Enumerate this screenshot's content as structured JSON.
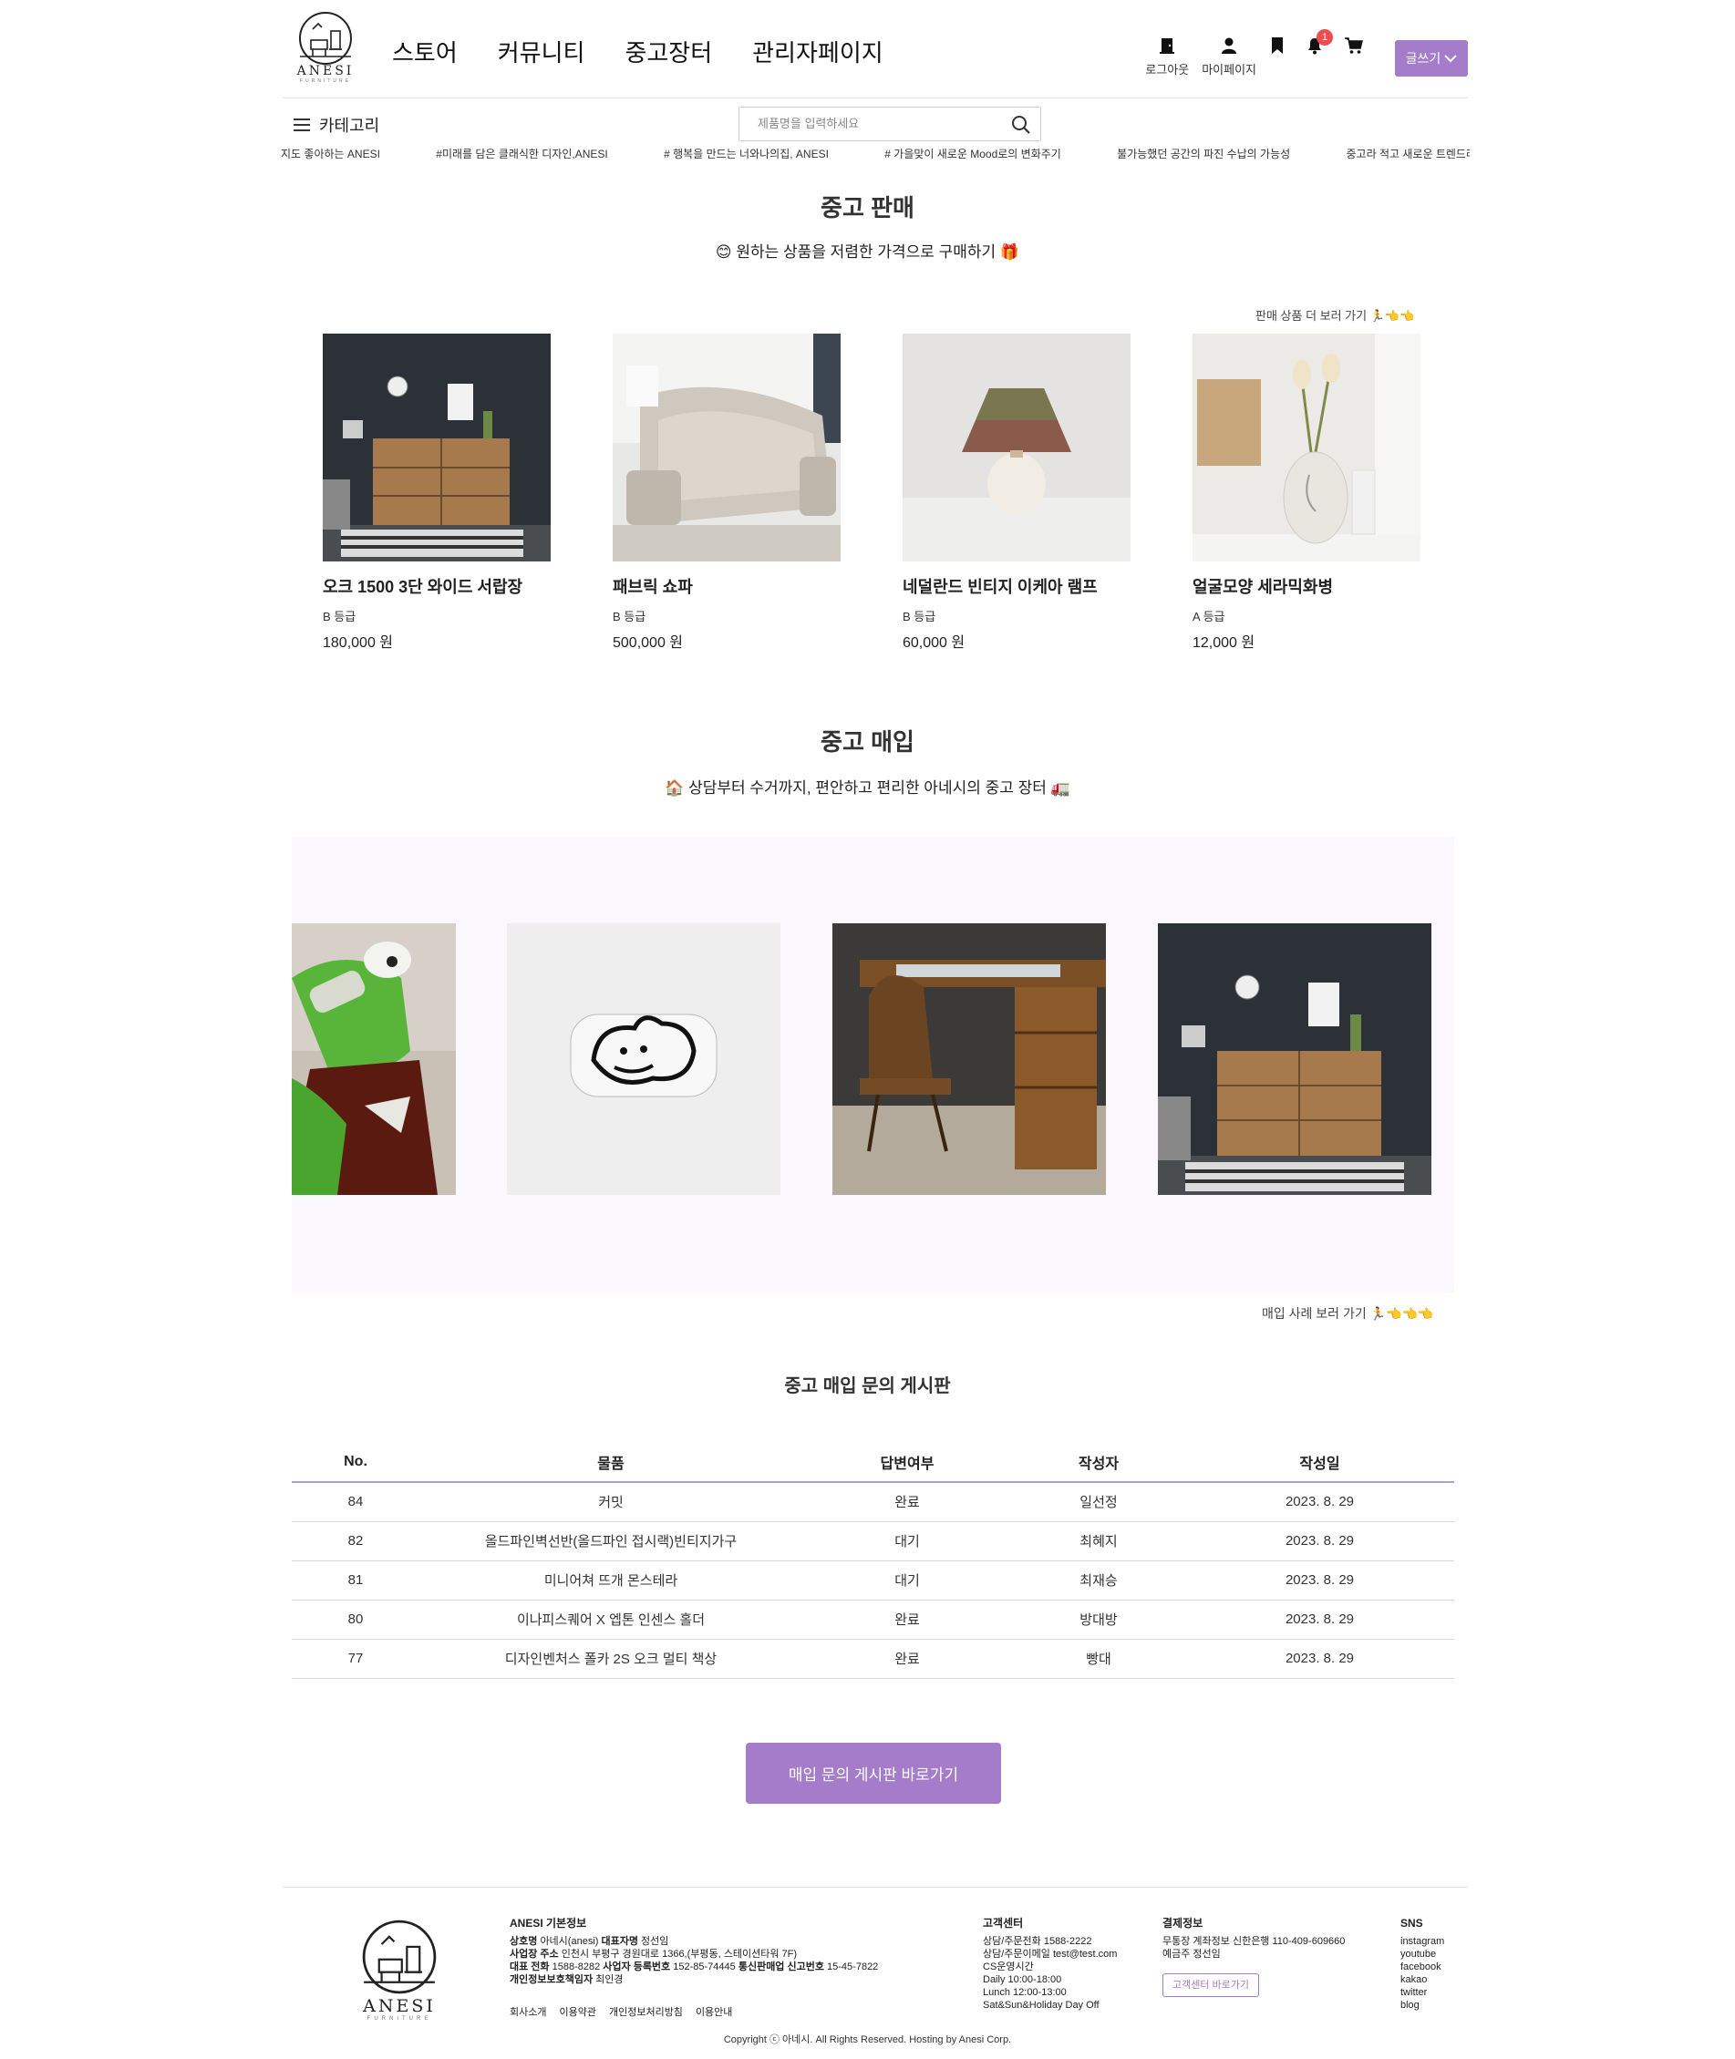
{
  "brand": {
    "name": "ANESI",
    "sub": "FURNITURE"
  },
  "nav": {
    "items": [
      "스토어",
      "커뮤니티",
      "중고장터",
      "관리자페이지"
    ]
  },
  "user_nav": {
    "logout": "로그아웃",
    "mypage": "마이페이지",
    "notification_count": "1",
    "write": "글쓰기"
  },
  "category": {
    "label": "카테고리"
  },
  "search": {
    "placeholder": "제품명을 입력하세요"
  },
  "ticker": [
    "지도 좋아하는 ANESI",
    "#미래를 담은 클래식한 디자인,ANESI",
    "# 행복을 만드는 너와나의집, ANESI",
    "# 가을맞이 새로운 Mood로의 변화주기",
    "불가능했던 공간의 파진 수납의 가능성",
    "중고라 적고 새로운 트렌드라"
  ],
  "sale": {
    "title": "중고 판매",
    "subtitle": "원하는 상품을 저렴한 가격으로 구매하기",
    "more": "판매 상품 더 보러 가기",
    "products": [
      {
        "name": "오크 1500 3단 와이드 서랍장",
        "grade": "B 등급",
        "price": "180,000 원"
      },
      {
        "name": "패브릭 쇼파",
        "grade": "B 등급",
        "price": "500,000 원"
      },
      {
        "name": "네덜란드 빈티지 이케아 램프",
        "grade": "B 등급",
        "price": "60,000 원"
      },
      {
        "name": "얼굴모양 세라믹화병",
        "grade": "A 등급",
        "price": "12,000 원"
      }
    ]
  },
  "buy": {
    "title": "중고 매입",
    "subtitle": "상담부터 수거까지, 편안하고 편리한 아네시의 중고 장터",
    "more": "매입 사례 보러 가기"
  },
  "board": {
    "title": "중고 매입 문의 게시판",
    "headers": [
      "No.",
      "물품",
      "답변여부",
      "작성자",
      "작성일"
    ],
    "rows": [
      {
        "no": "84",
        "item": "커밋",
        "status": "완료",
        "writer": "일선정",
        "date": "2023. 8. 29"
      },
      {
        "no": "82",
        "item": "올드파인벽선반(올드파인 접시랙)빈티지가구",
        "status": "대기",
        "writer": "최혜지",
        "date": "2023. 8. 29"
      },
      {
        "no": "81",
        "item": "미니어쳐 뜨개 몬스테라",
        "status": "대기",
        "writer": "최재승",
        "date": "2023. 8. 29"
      },
      {
        "no": "80",
        "item": "이나피스퀘어 X 엡톤 인센스 홀더",
        "status": "완료",
        "writer": "방대방",
        "date": "2023. 8. 29"
      },
      {
        "no": "77",
        "item": "디자인벤처스 폴카 2S 오크 멀티 책상",
        "status": "완료",
        "writer": "빵대",
        "date": "2023. 8. 29"
      }
    ],
    "button": "매입 문의 게시판 바로가기"
  },
  "footer": {
    "info_title": "ANESI 기본정보",
    "info_lines": [
      {
        "label": "상호명",
        "value": "아네시(anesi)"
      },
      {
        "label": "대표자명",
        "value": "정선임"
      },
      {
        "label": "사업장 주소",
        "value": "인천시 부평구 경원대로 1366,(부평동, 스테이션타워 7F)"
      },
      {
        "label": "대표 전화",
        "value": "1588-8282"
      },
      {
        "label": "사업자 등록번호",
        "value": "152-85-74445"
      },
      {
        "label": "통신판매업 신고번호",
        "value": "15-45-7822"
      },
      {
        "label": "개인정보보호책임자",
        "value": "최인경"
      }
    ],
    "links": [
      "회사소개",
      "이용약관",
      "개인정보처리방침",
      "이용안내"
    ],
    "cs_title": "고객센터",
    "cs_lines": [
      "상담/주문전화 1588-2222",
      "상담/주문이메일 test@test.com",
      "CS운영시간",
      "Daily 10:00-18:00",
      "Lunch 12:00-13:00",
      "Sat&Sun&Holiday Day Off"
    ],
    "pay_title": "결제정보",
    "pay_lines": [
      "무통장 계좌정보 신한은행 110-409-609660",
      "예금주 정선임"
    ],
    "cs_button": "고객센터 바로가기",
    "sns_title": "SNS",
    "sns": [
      "instagram",
      "youtube",
      "facebook",
      "kakao",
      "twitter",
      "blog"
    ],
    "copyright": "Copyright ⓒ 아네시. All Rights Reserved. Hosting by Anesi Corp."
  },
  "colors": {
    "accent": "#a57cc9",
    "badge": "#ee4d4d",
    "carousel_bg": "#fbf8fd"
  }
}
